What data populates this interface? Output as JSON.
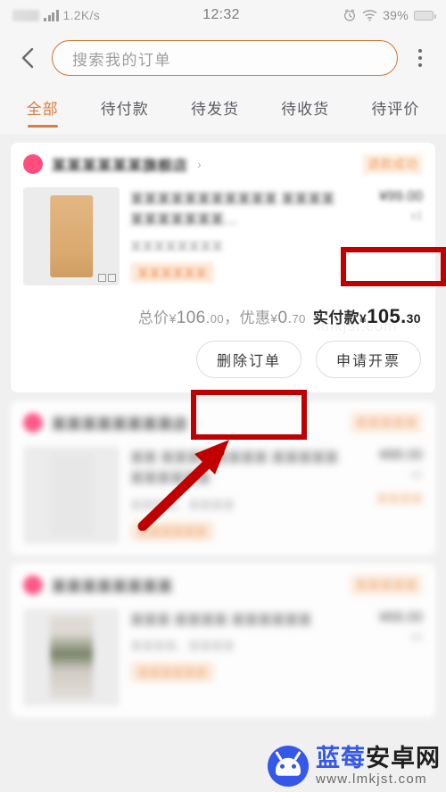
{
  "statusbar": {
    "network_speed": "1.2K/s",
    "time": "12:32",
    "battery_percent": "39%",
    "icons": [
      "signal-bars-icon",
      "alarm-clock-icon",
      "wifi-icon",
      "battery-icon"
    ]
  },
  "header": {
    "back_icon": "chevron-left-icon",
    "search_placeholder": "搜索我的订单",
    "more_icon": "more-vertical-icon"
  },
  "tabs": [
    {
      "label": "全部",
      "active": true
    },
    {
      "label": "待付款",
      "active": false
    },
    {
      "label": "待发货",
      "active": false
    },
    {
      "label": "待收货",
      "active": false
    },
    {
      "label": "待评价",
      "active": false
    }
  ],
  "orders": [
    {
      "shop_name": "某某某某某某旗舰店",
      "status": "退款成功",
      "goods_title": "某某某某某某某某某某某 某某某某某某某某某某某…",
      "goods_spec": "某某某某某某某某",
      "goods_tag": "某某某某某某",
      "price": "¥99.00",
      "qty": "x1",
      "totals": {
        "total_label": "总价",
        "total_value": "106",
        "total_cents": "00",
        "discount_label": "优惠",
        "discount_value": "0",
        "discount_cents": "70",
        "pay_label": "实付款",
        "pay_value": "105",
        "pay_cents": "30",
        "currency": "¥"
      },
      "actions": [
        {
          "label": "删除订单",
          "highlighted": true
        },
        {
          "label": "申请开票",
          "highlighted": false
        }
      ]
    },
    {
      "shop_name": "某某某某某某某某店",
      "status": "某某某某某",
      "goods_title": "某某 某某某某某某某某 某某某某某某某某某某某",
      "goods_spec": "某某某某，某某某某",
      "goods_tag": "某某某某某某",
      "price": "¥88.00",
      "qty": "x1",
      "sub_note": "某某某某"
    },
    {
      "shop_name": "某某某某某某某某",
      "status": "某某某某某",
      "goods_title": "某某某 某某某某 某某某某某某",
      "goods_spec": "某某某某，某某某某",
      "goods_tag": "某某某某某某",
      "price": "¥68.00",
      "qty": "x1"
    }
  ],
  "annotations": {
    "status_badge_box": "退款成功",
    "delete_button_box": "删除订单",
    "arrow": "red-arrow-pointing-to-delete-order"
  },
  "watermark": {
    "site_name_part1": "蓝莓",
    "site_name_part2": "安卓网",
    "url": "www.lmkjst.com",
    "faint_url": "lmkjst.com",
    "logo_icon": "android-robot-icon"
  },
  "colors": {
    "accent": "#e2793a",
    "search_border": "#d4732c",
    "annotation_red": "#c00000",
    "shop_dot": "#ff4d7e",
    "watermark_blue": "#3558e8"
  }
}
